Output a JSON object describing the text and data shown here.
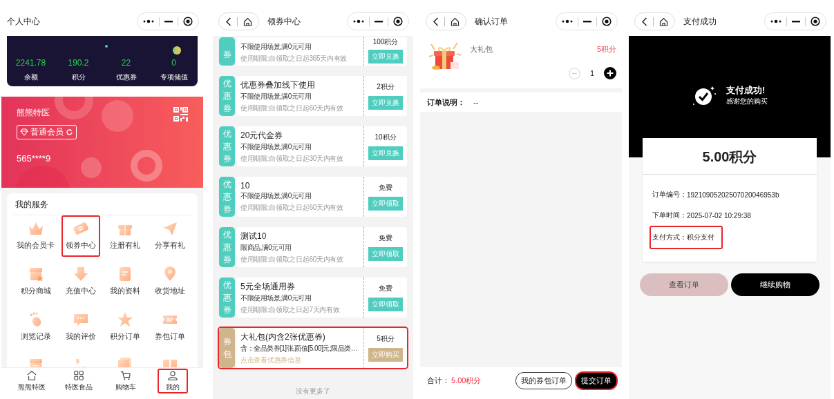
{
  "profile_screen": {
    "title": "个人中心",
    "stats": [
      {
        "value": "2241.78",
        "label": "余额"
      },
      {
        "value": "190.2",
        "label": "积分"
      },
      {
        "value": "22",
        "label": "优惠券"
      },
      {
        "value": "0",
        "label": "专项储值"
      }
    ],
    "member_card": {
      "name": "熊熊特医",
      "level": "普通会员",
      "phone": "565****9"
    },
    "services": {
      "title": "我的服务",
      "items": [
        {
          "label": "我的会员卡",
          "highlighted": false
        },
        {
          "label": "领券中心",
          "highlighted": true
        },
        {
          "label": "注册有礼",
          "highlighted": false
        },
        {
          "label": "分享有礼",
          "highlighted": false
        },
        {
          "label": "积分商城",
          "highlighted": false
        },
        {
          "label": "充值中心",
          "highlighted": false
        },
        {
          "label": "我的资料",
          "highlighted": false
        },
        {
          "label": "收货地址",
          "highlighted": false
        },
        {
          "label": "浏览记录",
          "highlighted": false
        },
        {
          "label": "我的评价",
          "highlighted": false
        },
        {
          "label": "积分订单",
          "highlighted": false
        },
        {
          "label": "券包订单",
          "highlighted": false
        },
        {
          "highlighted": false
        },
        {
          "highlighted": false
        },
        {
          "highlighted": false
        },
        {
          "highlighted": false
        }
      ]
    },
    "tabs": [
      {
        "label": "熊熊特医",
        "highlighted": false
      },
      {
        "label": "特医食品",
        "highlighted": false
      },
      {
        "label": "购物车",
        "highlighted": false
      },
      {
        "label": "我的",
        "highlighted": true
      }
    ]
  },
  "coupon_screen": {
    "title": "领券中心",
    "coupons": [
      {
        "kind": "coupon",
        "tag": "券",
        "condition": "不限使用场景,满0元可用",
        "note": "使用期限:自领取之日起365天内有效",
        "price": "100积分",
        "action": "立即兑换",
        "highlighted": false
      },
      {
        "kind": "coupon",
        "tag": "优惠券",
        "title": "优惠券叠加线下使用",
        "condition": "不限使用场景,满0元可用",
        "note": "使用期限:自领取之日起60天内有效",
        "price": "2积分",
        "action": "立即兑换",
        "highlighted": false
      },
      {
        "kind": "coupon",
        "tag": "优惠券",
        "title": "20元代金券",
        "condition": "不限使用场景,满0元可用",
        "note": "使用期限:自领取之日起30天内有效",
        "price": "10积分",
        "action": "立即兑换",
        "highlighted": false
      },
      {
        "kind": "coupon",
        "tag": "优惠券",
        "title": "10",
        "condition": "不限使用场景,满0元可用",
        "note": "使用期限:自领取之日起60天内有效",
        "price": "免费",
        "action": "立即领取",
        "highlighted": false
      },
      {
        "kind": "coupon",
        "tag": "优惠券",
        "title": "测试10",
        "condition": "限商品,满0元可用",
        "note": "使用期限:自领取之日起60天内有效",
        "price": "免费",
        "action": "立即领取",
        "highlighted": false
      },
      {
        "kind": "coupon",
        "tag": "优惠券",
        "title": "5元全场通用券",
        "condition": "不限使用场景,满0元可用",
        "note": "使用期限:自领取之日起7天内有效",
        "price": "免费",
        "action": "立即领取",
        "highlighted": false
      },
      {
        "kind": "bundle",
        "tag": "券包",
        "title": "大礼包(内含2张优惠券)",
        "condition": "含：全品类券[1]张,面值[5.00]元;限品类…",
        "note": "点击查看优惠券信息",
        "price": "5积分",
        "action": "立即购买",
        "highlighted": true
      }
    ],
    "footer": "没有更多了"
  },
  "order_screen": {
    "title": "确认订单",
    "product": {
      "name": "大礼包",
      "price": "5积分",
      "quantity": "1"
    },
    "note": {
      "label": "订单说明：",
      "value": "--"
    },
    "total": {
      "label": "合计：",
      "value": "5.00积分"
    },
    "buttons": [
      {
        "label": "我的券包订单",
        "kind": "outline",
        "highlighted": false
      },
      {
        "label": "提交订单",
        "kind": "primary",
        "highlighted": true
      }
    ]
  },
  "success_screen": {
    "title": "支付成功",
    "banner": {
      "title": "支付成功!",
      "subtitle": "感谢您的购买"
    },
    "amount": "5.00积分",
    "rows": [
      {
        "label": "订单编号：",
        "value": "19210905202507020046953b",
        "highlighted": false
      },
      {
        "label": "下单时间：",
        "value": "2025-07-02 10:29:38",
        "highlighted": false
      },
      {
        "label": "支付方式：",
        "value": "积分支付",
        "highlighted": true
      }
    ],
    "buttons": [
      {
        "label": "查看订单",
        "kind": "muted"
      },
      {
        "label": "继续购物",
        "kind": "primary"
      }
    ]
  }
}
